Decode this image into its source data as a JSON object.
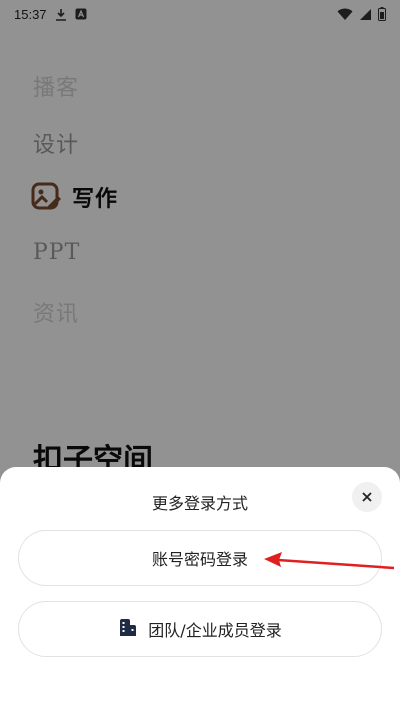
{
  "status_bar": {
    "time": "15:37",
    "left_icons": [
      "download-icon",
      "notification-a-icon"
    ],
    "right_icons": [
      "wifi-icon",
      "signal-icon",
      "battery-icon"
    ]
  },
  "background": {
    "items": [
      {
        "label": "播客"
      },
      {
        "label": "设计"
      },
      {
        "label": "写作",
        "icon": "image-edit-icon"
      },
      {
        "label": "PPT"
      },
      {
        "label": "资讯"
      }
    ],
    "space_title": "扣子空间"
  },
  "sheet": {
    "title": "更多登录方式",
    "close_icon": "close-icon",
    "password_login_label": "账号密码登录",
    "team_login_label": "团队/企业成员登录",
    "team_login_icon": "building-icon"
  },
  "annotation": {
    "arrow_color": "#e02020"
  },
  "colors": {
    "accent_brown": "#7a4a2e",
    "overlay": "rgba(0,0,0,0.42)"
  }
}
